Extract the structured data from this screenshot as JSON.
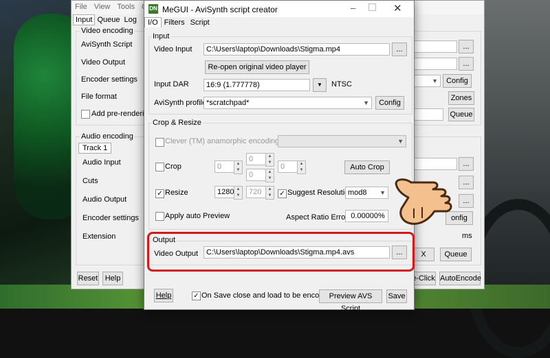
{
  "back_window": {
    "menu": [
      "File",
      "View",
      "Tools",
      "Op"
    ],
    "tabs": [
      "Input",
      "Queue",
      "Log"
    ],
    "video_encoding": {
      "title": "Video encoding",
      "avisynth_script": "AviSynth Script",
      "video_output": "Video Output",
      "encoder_settings": "Encoder settings",
      "file_format": "File format",
      "add_prerendering": "Add pre-rendering j",
      "config": "Config",
      "zones": "Zones",
      "queue": "Queue",
      "browse": "..."
    },
    "audio_encoding": {
      "title": "Audio encoding",
      "track": "Track 1",
      "audio_input": "Audio Input",
      "cuts": "Cuts",
      "audio_output": "Audio Output",
      "encoder_settings": "Encoder settings",
      "extension": "Extension",
      "config": "onfig",
      "ms": "ms",
      "x": "X",
      "queue": "Queue",
      "browse": "..."
    },
    "footer": {
      "reset": "Reset",
      "help": "Help",
      "one_click": "e-Click",
      "autoencode": "AutoEncode"
    }
  },
  "dialog": {
    "title": "MeGUI - AviSynth script creator",
    "icon_text": "DN",
    "tabs": [
      "I/O",
      "Filters",
      "Script"
    ],
    "input": {
      "title": "Input",
      "video_input_label": "Video Input",
      "video_input_value": "C:\\Users\\laptop\\Downloads\\Stigma.mp4",
      "browse": "...",
      "reopen": "Re-open original video player",
      "input_dar_label": "Input DAR",
      "input_dar_value": "16:9 (1.777778)",
      "ntsc": "NTSC",
      "avisynth_profile_label": "AviSynth profile",
      "avisynth_profile_value": "*scratchpad*",
      "config": "Config"
    },
    "crop_resize": {
      "title": "Crop & Resize",
      "clever_label": "Clever (TM) anamorphic encoding:",
      "crop_label": "Crop",
      "crop_left": "0",
      "crop_top": "0",
      "crop_bottom": "0",
      "crop_right": "0",
      "auto_crop": "Auto Crop",
      "resize_label": "Resize",
      "resize_width": "1280",
      "resize_height": "720",
      "suggest_resolution": "Suggest Resolution",
      "mod_value": "mod8",
      "auto_preview": "Apply auto Preview",
      "aspect_ratio_error_label": "Aspect Ratio Error",
      "aspect_ratio_error_value": "0.00000%"
    },
    "output": {
      "title": "Output",
      "video_output_label": "Video Output",
      "video_output_value": "C:\\Users\\laptop\\Downloads\\Stigma.mp4.avs",
      "browse": "..."
    },
    "footer": {
      "help": "Help",
      "on_save": "On Save close and load to be encoded",
      "preview": "Preview AVS Script",
      "save": "Save"
    }
  },
  "colors": {
    "highlight": "#d11a1a",
    "dialog_bg": "#f0f0f0",
    "hand": "#f3c08e"
  },
  "icons": [
    "minimize-icon",
    "maximize-icon",
    "close-icon",
    "hand-pointer-icon",
    "app-icon"
  ]
}
